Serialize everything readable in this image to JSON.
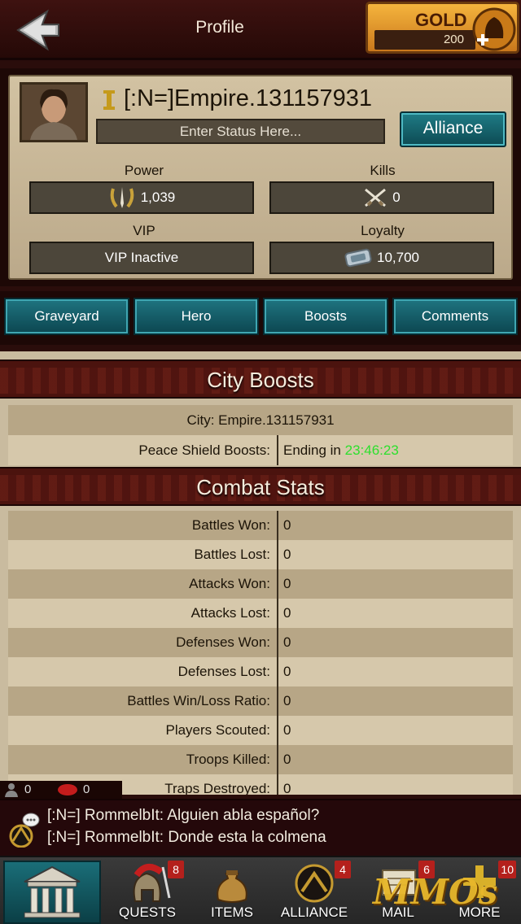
{
  "header": {
    "title": "Profile",
    "gold_label": "GOLD",
    "gold_value": "200"
  },
  "profile": {
    "name": "[:N=]Empire.131157931",
    "status_placeholder": "Enter Status Here...",
    "alliance_label": "Alliance",
    "power_label": "Power",
    "power_value": "1,039",
    "kills_label": "Kills",
    "kills_value": "0",
    "vip_label": "VIP",
    "vip_value": "VIP Inactive",
    "loyalty_label": "Loyalty",
    "loyalty_value": "10,700"
  },
  "tabs": [
    {
      "label": "Graveyard"
    },
    {
      "label": "Hero"
    },
    {
      "label": "Boosts"
    },
    {
      "label": "Comments"
    }
  ],
  "city_boosts": {
    "title": "City Boosts",
    "city_line": "City: Empire.131157931",
    "shield_label": "Peace Shield Boosts:",
    "shield_prefix": "Ending in ",
    "shield_timer": "23:46:23"
  },
  "combat_stats": {
    "title": "Combat Stats",
    "rows": [
      {
        "label": "Battles Won:",
        "value": "0"
      },
      {
        "label": "Battles Lost:",
        "value": "0"
      },
      {
        "label": "Attacks Won:",
        "value": "0"
      },
      {
        "label": "Attacks Lost:",
        "value": "0"
      },
      {
        "label": "Defenses Won:",
        "value": "0"
      },
      {
        "label": "Defenses Lost:",
        "value": "0"
      },
      {
        "label": "Battles Win/Loss Ratio:",
        "value": "0"
      },
      {
        "label": "Players Scouted:",
        "value": "0"
      },
      {
        "label": "Troops Killed:",
        "value": "0"
      },
      {
        "label": "Traps Destroyed:",
        "value": "0"
      }
    ]
  },
  "counters": {
    "players": "0",
    "messages": "0"
  },
  "chat": {
    "lines": [
      "[:N=] RommelbIt: Alguien abla español?",
      "[:N=] RommelbIt: Donde esta la colmena"
    ]
  },
  "nav": {
    "items": [
      {
        "label": "QUESTS",
        "badge": "8"
      },
      {
        "label": "ITEMS",
        "badge": ""
      },
      {
        "label": "ALLIANCE",
        "badge": "4"
      },
      {
        "label": "MAIL",
        "badge": "6"
      },
      {
        "label": "MORE",
        "badge": "10"
      }
    ],
    "watermark": "MMOs"
  },
  "colors": {
    "accent_teal": "#1f7c86",
    "timer_green": "#2de02d",
    "badge_red": "#b4201c",
    "gold": "#f5b43d"
  }
}
